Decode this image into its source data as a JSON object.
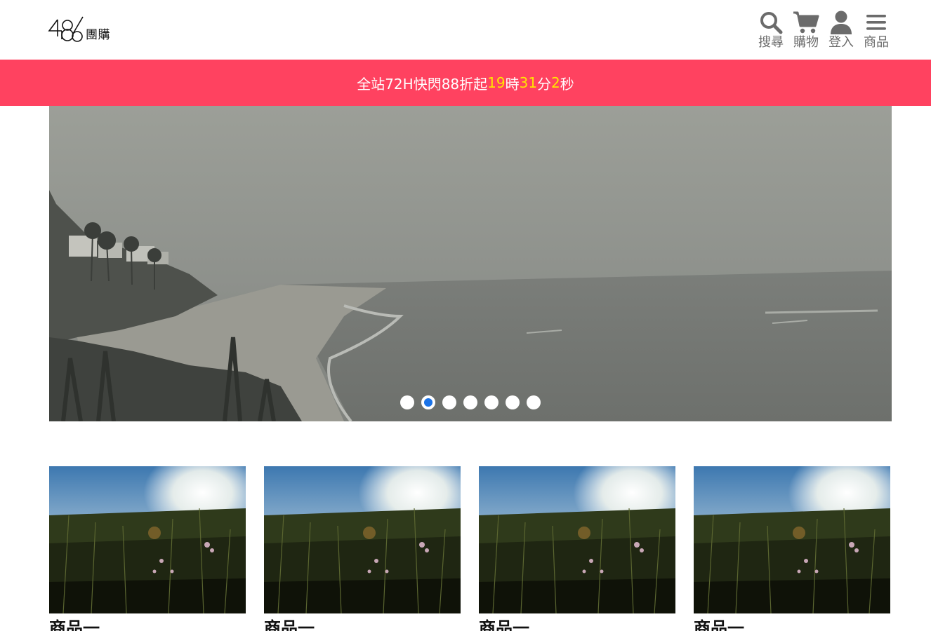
{
  "logo": {
    "mark": "486",
    "text": "團購"
  },
  "nav": {
    "items": [
      {
        "label": "搜尋",
        "icon": "search-icon"
      },
      {
        "label": "購物",
        "icon": "cart-icon"
      },
      {
        "label": "登入",
        "icon": "user-icon"
      },
      {
        "label": "商品",
        "icon": "menu-icon"
      }
    ],
    "icon_color": "#6b6b6b"
  },
  "banner": {
    "prefix": "全站72H快閃88折起 ",
    "hours": "19",
    "hours_unit": "時 ",
    "minutes": "31",
    "minutes_unit": "分 ",
    "seconds": "2",
    "seconds_unit": "秒",
    "background": "#ff4260",
    "number_color": "#ffe500"
  },
  "carousel": {
    "slide_count": 7,
    "active_index": 1,
    "active_color": "#1a73e8"
  },
  "products": [
    {
      "title": "商品一"
    },
    {
      "title": "商品一"
    },
    {
      "title": "商品一"
    },
    {
      "title": "商品一"
    }
  ]
}
